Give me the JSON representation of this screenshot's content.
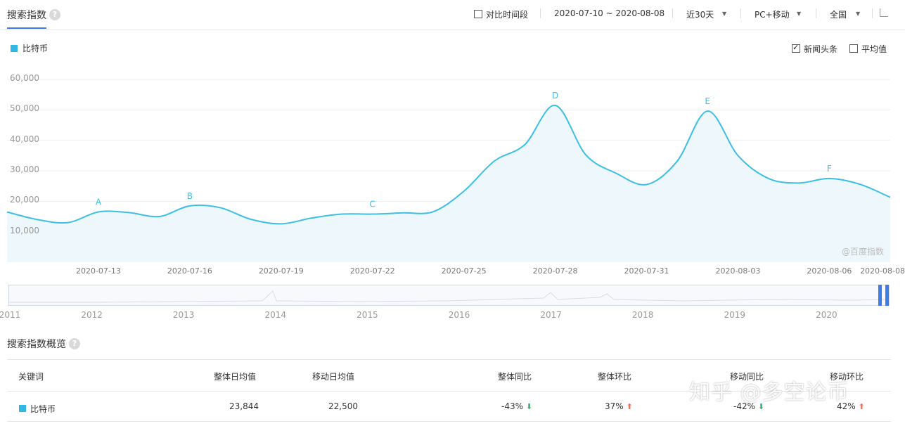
{
  "header": {
    "title": "搜索指数",
    "help_glyph": "?",
    "compare_label": "对比时间段",
    "date_range": "2020-07-10 ~ 2020-08-08",
    "period": "近30天",
    "device": "PC+移动",
    "region": "全国"
  },
  "legend": {
    "series_label": "比特币",
    "color": "#2fb8e6"
  },
  "options": {
    "news_label": "新闻头条",
    "news_checked": true,
    "avg_label": "平均值",
    "avg_checked": false
  },
  "brand_watermark": "@百度指数",
  "chart_data": {
    "type": "area",
    "ylim": [
      0,
      60000
    ],
    "yticks": [
      "60,000",
      "50,000",
      "40,000",
      "30,000",
      "20,000",
      "10,000"
    ],
    "grid": true,
    "x_ticks": [
      "2020-07-13",
      "2020-07-16",
      "2020-07-19",
      "2020-07-22",
      "2020-07-25",
      "2020-07-28",
      "2020-07-31",
      "2020-08-03",
      "2020-08-06",
      "2020-08-08"
    ],
    "x": [
      "2020-07-10",
      "2020-07-11",
      "2020-07-12",
      "2020-07-13",
      "2020-07-14",
      "2020-07-15",
      "2020-07-16",
      "2020-07-17",
      "2020-07-18",
      "2020-07-19",
      "2020-07-20",
      "2020-07-21",
      "2020-07-22",
      "2020-07-23",
      "2020-07-24",
      "2020-07-25",
      "2020-07-26",
      "2020-07-27",
      "2020-07-28",
      "2020-07-29",
      "2020-07-30",
      "2020-07-31",
      "2020-08-01",
      "2020-08-02",
      "2020-08-03",
      "2020-08-04",
      "2020-08-05",
      "2020-08-06",
      "2020-08-07",
      "2020-08-08"
    ],
    "series": [
      {
        "values": [
          16500,
          14000,
          13000,
          16500,
          16300,
          15000,
          18500,
          17900,
          14100,
          12600,
          14500,
          15800,
          15800,
          16200,
          16600,
          23300,
          33200,
          38600,
          51500,
          35300,
          29200,
          25500,
          33100,
          49600,
          35000,
          27500,
          26000,
          27500,
          25600,
          21300
        ]
      }
    ],
    "annotations": [
      {
        "label": "A",
        "x": "2020-07-13",
        "y": 16500
      },
      {
        "label": "B",
        "x": "2020-07-16",
        "y": 18500
      },
      {
        "label": "C",
        "x": "2020-07-22",
        "y": 15800
      },
      {
        "label": "D",
        "x": "2020-07-28",
        "y": 51500
      },
      {
        "label": "E",
        "x": "2020-08-02",
        "y": 49600
      },
      {
        "label": "F",
        "x": "2020-08-06",
        "y": 27500
      }
    ],
    "line_color": "#3bbfe3"
  },
  "timeline": {
    "years": [
      "2011",
      "2012",
      "2013",
      "2014",
      "2015",
      "2016",
      "2017",
      "2018",
      "2019",
      "2020"
    ]
  },
  "overview": {
    "title": "搜索指数概览",
    "columns": [
      "关键词",
      "整体日均值",
      "移动日均值",
      "整体同比",
      "整体环比",
      "移动同比",
      "移动环比"
    ],
    "row": {
      "keyword": "比特币",
      "overall_avg": "23,844",
      "mobile_avg": "22,500",
      "overall_yoy": "-43%",
      "overall_mom": "37%",
      "mobile_yoy": "-42%",
      "mobile_mom": "42%"
    }
  },
  "zhihu_watermark": "知乎 @多空论币"
}
